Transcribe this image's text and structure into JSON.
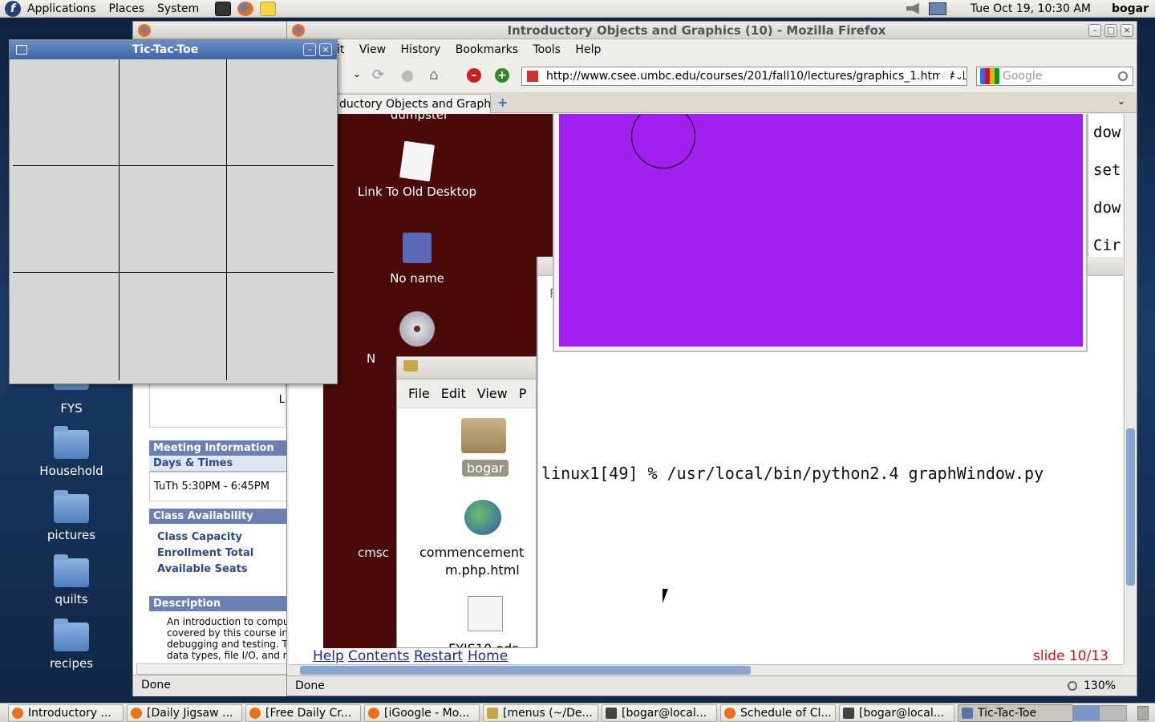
{
  "top_panel": {
    "menus": [
      "Applications",
      "Places",
      "System"
    ],
    "clock": "Tue Oct 19, 10:30 AM",
    "user": "bogar"
  },
  "desktop_icons": [
    {
      "label": "FYS"
    },
    {
      "label": "Household"
    },
    {
      "label": "pictures"
    },
    {
      "label": "quilts"
    },
    {
      "label": "recipes"
    }
  ],
  "inner_desktop_icons": [
    {
      "label": "dumpster"
    },
    {
      "label": "Link To Old Desktop"
    },
    {
      "label": "No name"
    },
    {
      "label": "N"
    },
    {
      "label": "cmsc"
    }
  ],
  "firefox": {
    "title": "Introductory Objects and Graphics (10) - Mozilla Firefox",
    "menu": [
      "it",
      "View",
      "History",
      "Bookmarks",
      "Tools",
      "Help"
    ],
    "url": "http://www.csee.umbc.edu/courses/201/fall10/lectures/graphics_1.html#(1(",
    "search_placeholder": "Google",
    "tab_label": "ductory Objects and Graph...",
    "status": "Done",
    "zoom": "130%",
    "slide_nav": [
      "Help",
      "Contents",
      "Restart",
      "Home"
    ],
    "slide_counter": "slide 10/13",
    "side_code": [
      "dow",
      "set",
      "dow.",
      "Cir"
    ],
    "terminal_cmd": "linux1[49] % /usr/local/bin/python2.4 graphWindow.py",
    "side_letter": "F"
  },
  "back_firefox": {
    "status": "Done",
    "char_l": "L",
    "meeting": {
      "header": "Meeting Information",
      "subheader": "Days & Times",
      "times": "TuTh 5:30PM - 6:45PM"
    },
    "availability": {
      "header": "Class Availability",
      "items": [
        "Class Capacity",
        "Enrollment Total",
        "Available Seats"
      ]
    },
    "description": {
      "header": "Description",
      "lines": [
        "An introduction to comput",
        "covered by this course inc",
        "debugging and testing. Th",
        "data types, file I/O, and r"
      ]
    }
  },
  "file_manager": {
    "menu": [
      "File",
      "Edit",
      "View",
      "P"
    ],
    "items": [
      "bogar",
      "commencement",
      "m.php.html",
      "FYIS10.ods"
    ]
  },
  "tic_tac_toe": {
    "title": "Tic-Tac-Toe"
  },
  "taskbar": [
    {
      "label": "Introductory ...",
      "color": "#e8711c"
    },
    {
      "label": "[Daily Jigsaw ...",
      "color": "#e8711c"
    },
    {
      "label": "[Free Daily Cr...",
      "color": "#e8711c"
    },
    {
      "label": "[iGoogle - Mo...",
      "color": "#e8711c"
    },
    {
      "label": "[menus (~/De...",
      "color": "#c9a44a"
    },
    {
      "label": "[bogar@local...",
      "color": "#444444"
    },
    {
      "label": "Schedule of Cl...",
      "color": "#e8711c"
    },
    {
      "label": "[bogar@local...",
      "color": "#444444"
    },
    {
      "label": "Tic-Tac-Toe",
      "color": "#5577aa"
    }
  ],
  "colors": {
    "graphics_fill": "#a020f0",
    "inner_desktop": "#4a0a0a",
    "slide_counter": "#d01010"
  }
}
